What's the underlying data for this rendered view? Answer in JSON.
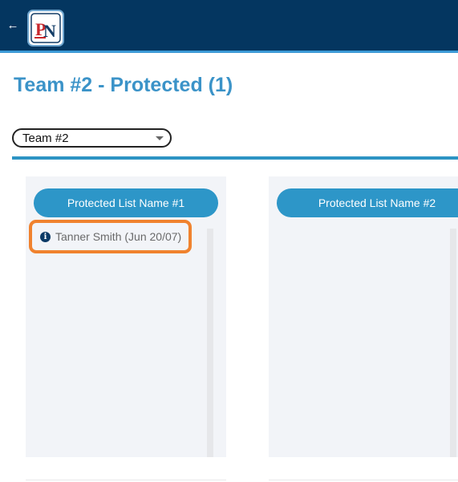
{
  "header": {
    "back_icon": "arrow-left-icon",
    "logo_text": "PN",
    "colors": {
      "bar": "#043660",
      "bar_border": "#3d9ad6"
    }
  },
  "page": {
    "title": "Team #2 - Protected (1)",
    "title_color": "#3b93c8"
  },
  "team_select": {
    "value": "Team #2"
  },
  "lists": [
    {
      "name": "Protected List Name #1",
      "players": [
        {
          "icon": "info-icon",
          "label": "Tanner Smith (Jun 20/07)",
          "highlighted": true
        }
      ]
    },
    {
      "name": "Protected List Name #2",
      "players": []
    }
  ],
  "colors": {
    "accent": "#2d96c8",
    "highlight": "#f0822e",
    "panel_bg": "#f2f4f8"
  }
}
